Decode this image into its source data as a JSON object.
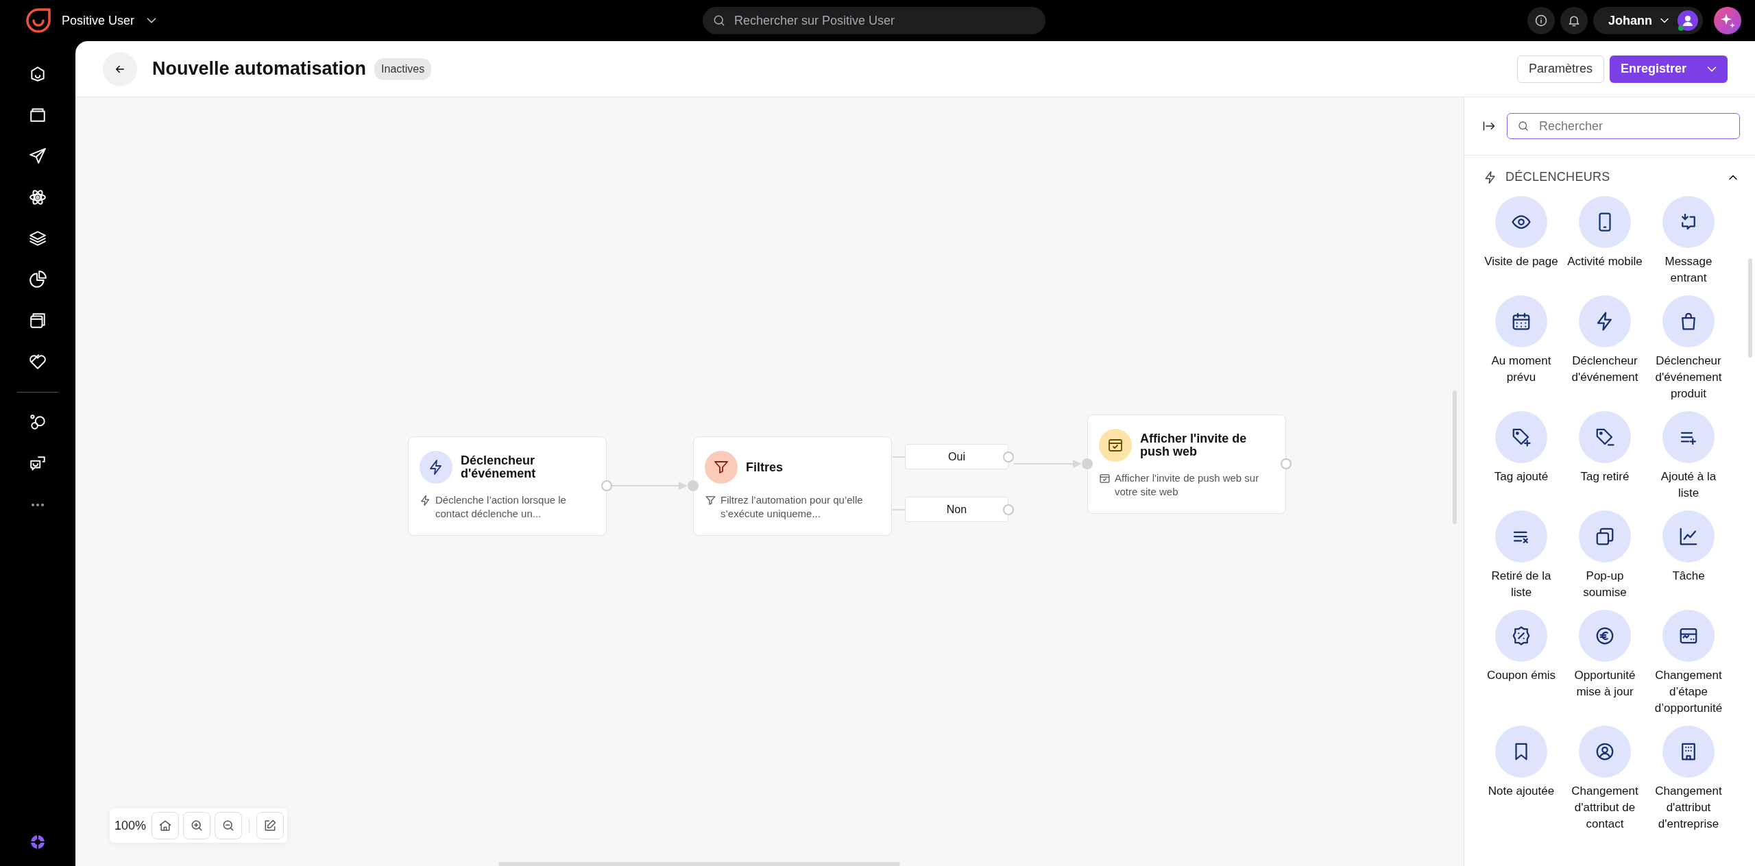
{
  "topbar": {
    "brand": "Positive User",
    "search": {
      "placeholder": "Rechercher sur Positive User"
    },
    "user": "Johann"
  },
  "header": {
    "title": "Nouvelle automatisation",
    "status": "Inactives",
    "settings_button": "Paramètres",
    "save_button": "Enregistrer"
  },
  "canvas": {
    "nodes": [
      {
        "title": "Déclencheur d'événement",
        "description": "Déclenche l’action lorsque le contact déclenche un...",
        "color": "#dfe4fc"
      },
      {
        "title": "Filtres",
        "description": "Filtrez l’automation pour qu’elle s’exécute uniqueme...",
        "color": "#fbcab8"
      },
      {
        "title": "Afficher l'invite de push web",
        "description": "Afficher l'invite de push web sur votre site web",
        "color": "#fde3a7"
      }
    ],
    "branches": [
      {
        "label": "Oui"
      },
      {
        "label": "Non"
      }
    ],
    "zoom": "100%"
  },
  "panel": {
    "search": {
      "placeholder": "Rechercher"
    },
    "section": {
      "title": "DÉCLENCHEURS",
      "expanded": true
    },
    "items": [
      {
        "label": "Visite de page"
      },
      {
        "label": "Activité mobile"
      },
      {
        "label": "Message entrant"
      },
      {
        "label": "Au moment prévu"
      },
      {
        "label": "Déclencheur d'événement"
      },
      {
        "label": "Déclencheur d'événement produit"
      },
      {
        "label": "Tag ajouté"
      },
      {
        "label": "Tag retiré"
      },
      {
        "label": "Ajouté à la liste"
      },
      {
        "label": "Retiré de la liste"
      },
      {
        "label": "Pop-up soumise"
      },
      {
        "label": "Tâche"
      },
      {
        "label": "Coupon émis"
      },
      {
        "label": "Opportunité mise à jour"
      },
      {
        "label": "Changement d’étape d’opportunité"
      },
      {
        "label": "Note ajoutée"
      },
      {
        "label": "Changement d'attribut de contact"
      },
      {
        "label": "Changement d'attribut d'entreprise"
      }
    ]
  }
}
